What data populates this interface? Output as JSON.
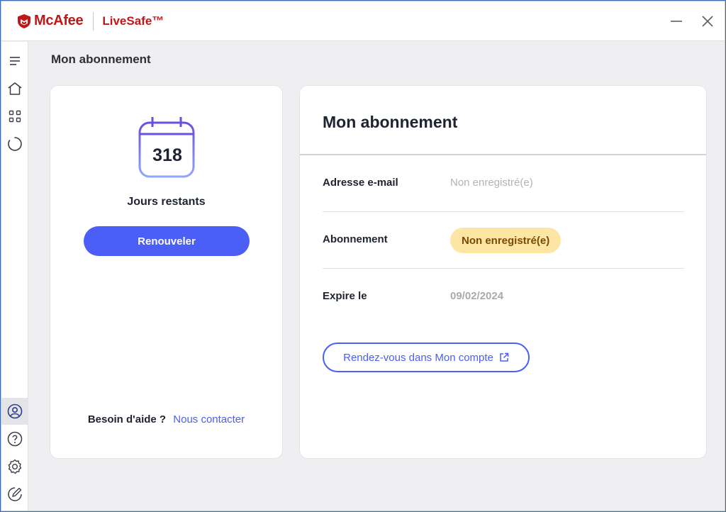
{
  "app": {
    "brand_name": "McAfee",
    "product_name": "LiveSafe™",
    "brand_color": "#c01818",
    "accent_color": "#4b5ef5"
  },
  "window_controls": {
    "minimize_icon": "minimize-icon",
    "close_icon": "close-icon"
  },
  "sidebar": {
    "top_items": [
      "menu-icon",
      "home-icon",
      "apps-grid-icon",
      "progress-ring-icon"
    ],
    "bottom_items": [
      "account-icon",
      "help-icon",
      "settings-icon",
      "feedback-icon"
    ],
    "active_item": "account-icon"
  },
  "page": {
    "title": "Mon abonnement"
  },
  "left_card": {
    "days_remaining": "318",
    "days_label": "Jours restants",
    "renew_label": "Renouveler",
    "help_question": "Besoin d'aide ?",
    "help_link": "Nous contacter"
  },
  "right_card": {
    "title": "Mon abonnement",
    "rows": [
      {
        "label": "Adresse e-mail",
        "value": "Non enregistré(e)"
      },
      {
        "label": "Abonnement",
        "value": "Non enregistré(e)"
      },
      {
        "label": "Expire le",
        "value": "09/02/2024"
      }
    ],
    "account_button": "Rendez-vous dans Mon compte",
    "badge_color": "#fde6a3"
  }
}
